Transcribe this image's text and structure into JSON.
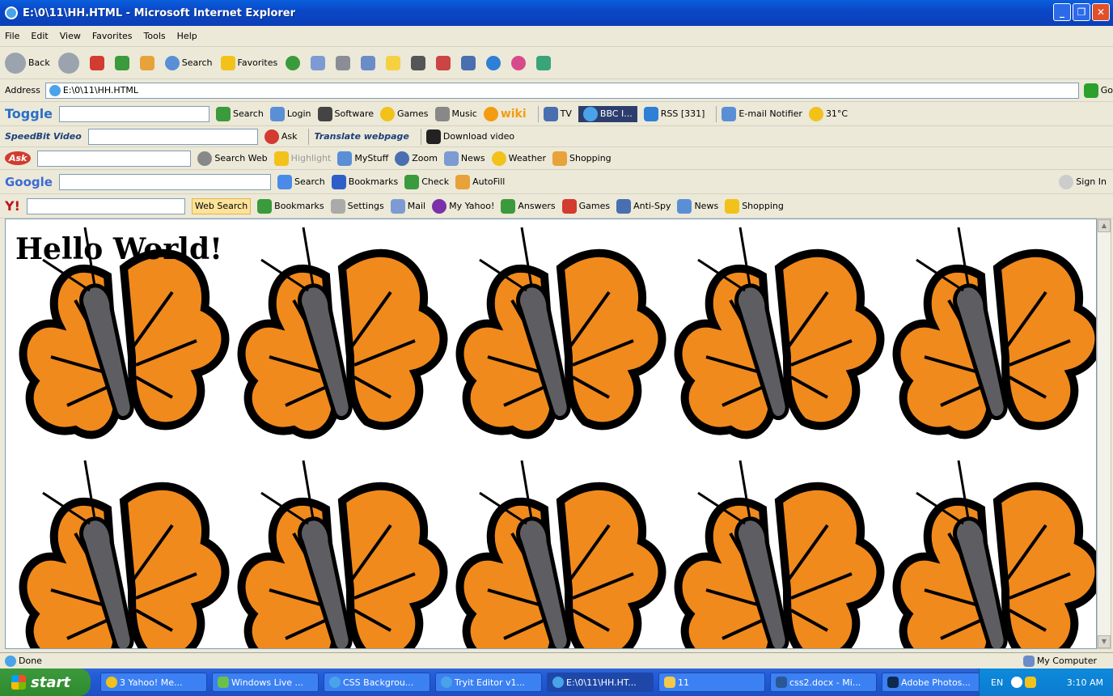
{
  "window": {
    "title": "E:\\0\\11\\HH.HTML - Microsoft Internet Explorer",
    "buttons": [
      "_",
      "❐",
      "✕"
    ]
  },
  "menu": [
    "File",
    "Edit",
    "View",
    "Favorites",
    "Tools",
    "Help"
  ],
  "standard_toolbar": {
    "back": "Back",
    "search": "Search",
    "favorites": "Favorites"
  },
  "address": {
    "label": "Address",
    "value": "E:\\0\\11\\HH.HTML",
    "go": "Go"
  },
  "toggle_bar": {
    "brand": "Toggle",
    "search": "Search",
    "login": "Login",
    "software": "Software",
    "games": "Games",
    "music": "Music",
    "wiki": "wiki",
    "tv": "TV",
    "radio": "BBC I...",
    "rss": "RSS [331]",
    "email": "E-mail Notifier",
    "temp": "31°C"
  },
  "speedbit_bar": {
    "brand": "SpeedBit Video",
    "ask": "Ask",
    "translate": "Translate webpage",
    "download": "Download video"
  },
  "ask_bar": {
    "brand": "Ask",
    "search_web": "Search Web",
    "highlight": "Highlight",
    "mystuff": "MyStuff",
    "zoom": "Zoom",
    "news": "News",
    "weather": "Weather",
    "shopping": "Shopping"
  },
  "google_bar": {
    "brand": "Google",
    "search": "Search",
    "bookmarks": "Bookmarks",
    "check": "Check",
    "autofill": "AutoFill",
    "signin": "Sign In"
  },
  "yahoo_bar": {
    "brand": "Y!",
    "web_search": "Web Search",
    "bookmarks": "Bookmarks",
    "settings": "Settings",
    "mail": "Mail",
    "myyahoo": "My Yahoo!",
    "answers": "Answers",
    "games": "Games",
    "antispy": "Anti-Spy",
    "news": "News",
    "shopping": "Shopping"
  },
  "page": {
    "heading": "Hello World!",
    "background": "butterfly"
  },
  "status": {
    "text": "Done",
    "zone": "My Computer"
  },
  "taskbar": {
    "start": "start",
    "tasks": [
      "3 Yahoo! Me...",
      "Windows Live ...",
      "CSS Backgrou...",
      "Tryit Editor v1...",
      "E:\\0\\11\\HH.HT...",
      "11",
      "css2.docx - Mi...",
      "Adobe Photos..."
    ],
    "active_task": 4,
    "lang": "EN",
    "clock": "3:10 AM"
  },
  "colors": {
    "title_blue": "#0a48c8",
    "butterfly_orange": "#f08a1c",
    "body_gray": "#5e5d61",
    "taskbar_blue": "#245edb",
    "start_green": "#2f8a2f"
  }
}
